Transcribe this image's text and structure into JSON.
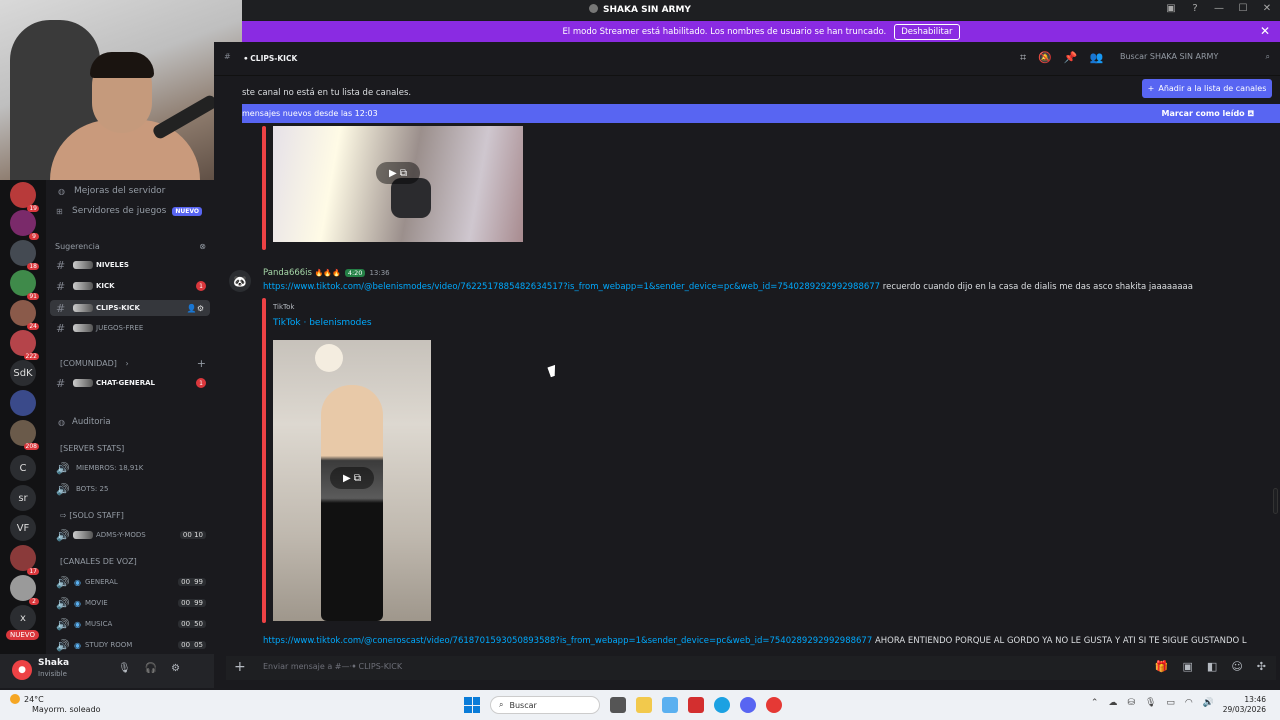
{
  "window": {
    "title": "SHAKA SIN ARMY"
  },
  "streamer_banner": {
    "text": "El modo Streamer está habilitado. Los nombres de usuario se han truncado.",
    "button": "Deshabilitar"
  },
  "servers": [
    {
      "label": "",
      "badge": "19",
      "color": "#b83a3a"
    },
    {
      "label": "",
      "badge": "9",
      "color": "#7a2a6a"
    },
    {
      "label": "",
      "badge": "18",
      "color": "#444a52"
    },
    {
      "label": "",
      "badge": "91",
      "color": "#3f8a4a"
    },
    {
      "label": "",
      "badge": "24",
      "color": "#8a5a4a"
    },
    {
      "label": "",
      "badge": "222",
      "color": "#b5444a"
    },
    {
      "label": "SdK",
      "badge": "",
      "color": "#2b2d31"
    },
    {
      "label": "",
      "badge": "",
      "color": "#3a4a8a"
    },
    {
      "label": "",
      "badge": "208",
      "color": "#6a5a4a"
    },
    {
      "label": "C",
      "badge": "",
      "color": "#2b2d31"
    },
    {
      "label": "sr",
      "badge": "",
      "color": "#2b2d31"
    },
    {
      "label": "VF",
      "badge": "",
      "color": "#2b2d31"
    },
    {
      "label": "",
      "badge": "17",
      "color": "#8a3a3a"
    },
    {
      "label": "",
      "badge": "2",
      "color": "#9a9a9a"
    },
    {
      "label": "x",
      "badge": "",
      "color": "#2b2d31"
    }
  ],
  "servers_new_label": "NUEVO",
  "sidebar": {
    "boosts": "Mejoras del servidor",
    "game_servers": "Servidores de juegos",
    "game_servers_badge": "NUEVO",
    "suggestion_header": "Sugerencia",
    "channels": [
      {
        "name": "NIVELES",
        "badge": "",
        "bold": true
      },
      {
        "name": "KICK",
        "badge": "1",
        "bold": true
      },
      {
        "name": "CLIPS-KICK",
        "badge": "",
        "bold": true,
        "selected": true
      },
      {
        "name": "JUEGOS-FREE",
        "badge": "",
        "bold": false
      }
    ],
    "community_header": "[COMUNIDAD]",
    "community_channels": [
      {
        "name": "CHAT-GENERAL",
        "badge": "1"
      }
    ],
    "audit": "Auditoria",
    "server_stats_header": "[SERVER STATS]",
    "stats": [
      {
        "name": "MIEMBROS: 18,91k"
      },
      {
        "name": "BOTS: 25"
      }
    ],
    "staff_header": "[SOLO STAFF]",
    "staff_channels": [
      {
        "name": "ADMS-Y-MODS",
        "count": "00",
        "limit": "10"
      }
    ],
    "voice_header": "[CANALES DE VOZ]",
    "voice_channels": [
      {
        "name": "GENERAL",
        "count": "00",
        "limit": "99"
      },
      {
        "name": "MOVIE",
        "count": "00",
        "limit": "99"
      },
      {
        "name": "MUSICA",
        "count": "00",
        "limit": "50"
      },
      {
        "name": "STUDY ROOM",
        "count": "00",
        "limit": "05"
      }
    ]
  },
  "user": {
    "name": "Shaka",
    "status": "Invisible"
  },
  "channel_header": {
    "name": "CLIPS-KICK",
    "search_placeholder": "Buscar SHAKA SIN ARMY"
  },
  "notice": {
    "text": "ste canal no está en tu lista de canales.",
    "button": "Añadir a la lista de canales"
  },
  "new_messages": {
    "text": "mensajes nuevos desde las 12:03",
    "mark_read": "Marcar como leído"
  },
  "message": {
    "author": "Panda666is",
    "tag": "4:20",
    "time": "13:36",
    "link": "https://www.tiktok.com/@belenismodes/video/7622517885482634517?is_from_webapp=1&sender_device=pc&web_id=7540289292992988677",
    "text": "recuerdo cuando dijo en la casa de dialis me das asco shakita jaaaaaaaa",
    "embed_site": "TikTok",
    "embed_title": "TikTok · belenismodes"
  },
  "message2": {
    "link": "https://www.tiktok.com/@coneroscast/video/7618701593050893588?is_from_webapp=1&sender_device=pc&web_id=7540289292992988677",
    "text": "AHORA ENTIENDO PORQUE AL GORDO YA NO LE GUSTA Y ATI SI TE SIGUE GUSTANDO L"
  },
  "input": {
    "placeholder": "Enviar mensaje a #—·ꔷ CLIPS-KICK"
  },
  "taskbar": {
    "weather_temp": "24°C",
    "weather_desc": "Mayorm. soleado",
    "search": "Buscar",
    "time": "13:46",
    "date": "29/03/2026"
  }
}
